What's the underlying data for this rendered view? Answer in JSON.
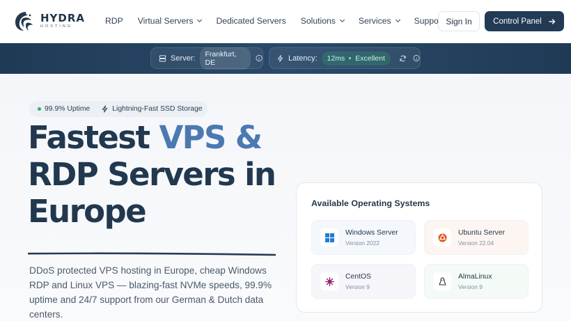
{
  "brand": {
    "name": "HYDRA",
    "sub": "HOSTING"
  },
  "nav": {
    "items": [
      {
        "label": "RDP",
        "dropdown": false
      },
      {
        "label": "Virtual Servers",
        "dropdown": true
      },
      {
        "label": "Dedicated Servers",
        "dropdown": false
      },
      {
        "label": "Solutions",
        "dropdown": true
      },
      {
        "label": "Services",
        "dropdown": true
      },
      {
        "label": "Support",
        "dropdown": false
      }
    ],
    "signin_label": "Sign In",
    "control_panel_label": "Control Panel"
  },
  "status": {
    "server_label": "Server:",
    "server_value": "Frankfurt, DE",
    "latency_label": "Latency:",
    "latency_value": "12ms",
    "latency_quality": "Excellent"
  },
  "hero": {
    "badge_uptime": "99.9% Uptime",
    "badge_storage": "Lightning-Fast SSD Storage",
    "title_part1": "Fastest ",
    "title_accent": "VPS &",
    "title_part2": "RDP Servers in Europe",
    "description": "DDoS protected VPS hosting in Europe, cheap Windows RDP and Linux VPS — blazing-fast NVMe speeds, 99.9% uptime and 24/7 support from our German & Dutch data centers."
  },
  "os_panel": {
    "title": "Available Operating Systems",
    "systems": [
      {
        "name": "Windows Server",
        "version": "Version 2022",
        "icon": "windows-icon",
        "tint": "#f4f7fb"
      },
      {
        "name": "Ubuntu Server",
        "version": "Version 22.04",
        "icon": "ubuntu-icon",
        "tint": "#fdf5f1"
      },
      {
        "name": "CentOS",
        "version": "Version 9",
        "icon": "centos-icon",
        "tint": "#f6f5fa"
      },
      {
        "name": "AlmaLinux",
        "version": "Version 9",
        "icon": "almalinux-icon",
        "tint": "#f4faf6"
      }
    ]
  },
  "colors": {
    "brand_dark": "#223a54",
    "accent_blue": "#4b79b2",
    "status_green": "#20b36b"
  }
}
